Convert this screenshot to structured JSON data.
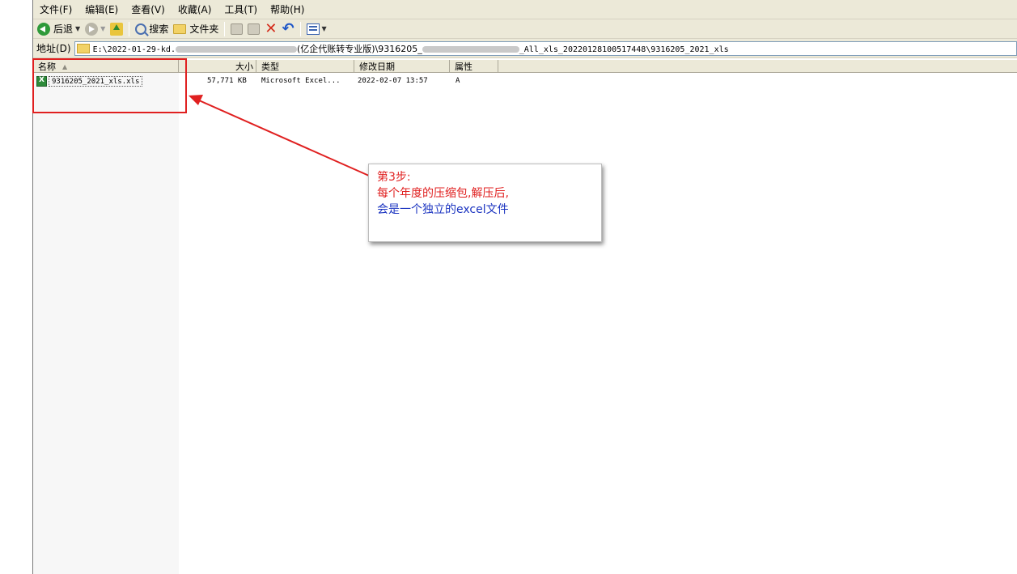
{
  "menu": [
    "文件(F)",
    "编辑(E)",
    "查看(V)",
    "收藏(A)",
    "工具(T)",
    "帮助(H)"
  ],
  "toolbar": {
    "back_label": "后退",
    "search_label": "搜索",
    "folders_label": "文件夹"
  },
  "address": {
    "label": "地址(D)",
    "path_prefix": "E:\\2022-01-29-kd.",
    "path_middle": "(亿企代账转专业版)\\9316205_",
    "path_suffix": "_All_xls_20220128100517448\\9316205_2021_xls"
  },
  "columns": {
    "name": "名称",
    "size": "大小",
    "type": "类型",
    "modified": "修改日期",
    "attributes": "属性"
  },
  "files": [
    {
      "name": "9316205_2021_xls.xls",
      "size": "57,771 KB",
      "type": "Microsoft Excel...",
      "modified": "2022-02-07 13:57",
      "attributes": "A"
    }
  ],
  "callout": {
    "line1": "第3步:",
    "line2": "每个年度的压缩包,解压后,",
    "line3": "会是一个独立的excel文件"
  },
  "colors": {
    "annotation_red": "#e02020",
    "annotation_blue": "#1a33c0",
    "chrome_bg": "#ece9d8"
  }
}
